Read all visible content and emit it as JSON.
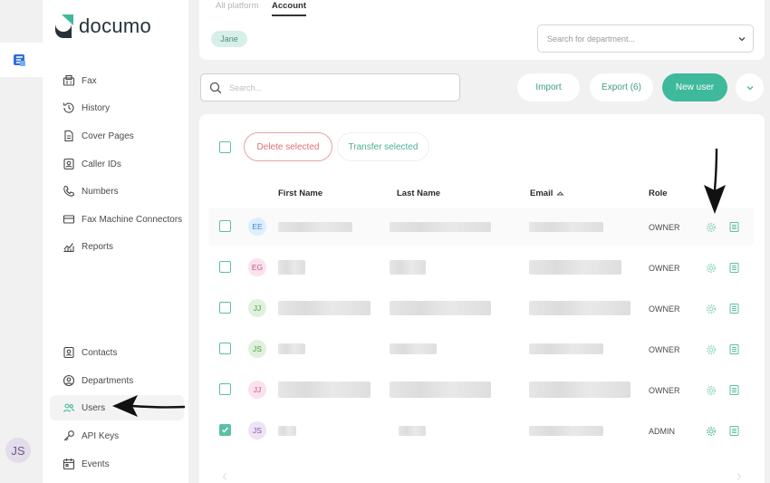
{
  "rail": {
    "avatar_initials": "JS"
  },
  "brand": {
    "name": "documo",
    "accent": "#3fb99c"
  },
  "sidebar": {
    "items": [
      {
        "label": "Fax",
        "icon": "fax-icon"
      },
      {
        "label": "History",
        "icon": "history-icon"
      },
      {
        "label": "Cover Pages",
        "icon": "cover-pages-icon"
      },
      {
        "label": "Caller IDs",
        "icon": "caller-id-icon"
      },
      {
        "label": "Numbers",
        "icon": "phone-icon"
      },
      {
        "label": "Fax Machine Connectors",
        "icon": "fax-machine-icon"
      },
      {
        "label": "Reports",
        "icon": "reports-icon"
      },
      {
        "label": "Contacts",
        "icon": "contacts-icon"
      },
      {
        "label": "Departments",
        "icon": "departments-icon"
      },
      {
        "label": "Users",
        "icon": "users-icon",
        "active": true
      },
      {
        "label": "API Keys",
        "icon": "key-icon"
      },
      {
        "label": "Events",
        "icon": "events-icon"
      }
    ]
  },
  "header": {
    "tabs": [
      {
        "label": "All platform"
      },
      {
        "label": "Account",
        "active": true
      }
    ],
    "filter_chip": "Jane",
    "department_placeholder": "Search for department..."
  },
  "toolbar": {
    "search_placeholder": "Search...",
    "import_label": "Import",
    "export_label": "Export (6)",
    "new_user_label": "New user"
  },
  "table": {
    "delete_label": "Delete selected",
    "transfer_label": "Transfer selected",
    "columns": {
      "first_name": "First Name",
      "last_name": "Last Name",
      "email": "Email",
      "role": "Role"
    },
    "rows": [
      {
        "initials": "EE",
        "role": "OWNER",
        "checked": false
      },
      {
        "initials": "EG",
        "role": "OWNER",
        "checked": false
      },
      {
        "initials": "JJ",
        "role": "OWNER",
        "checked": false
      },
      {
        "initials": "JS",
        "role": "OWNER",
        "checked": false
      },
      {
        "initials": "JJ",
        "role": "OWNER",
        "checked": false
      },
      {
        "initials": "JS",
        "role": "ADMIN",
        "checked": true
      }
    ]
  }
}
